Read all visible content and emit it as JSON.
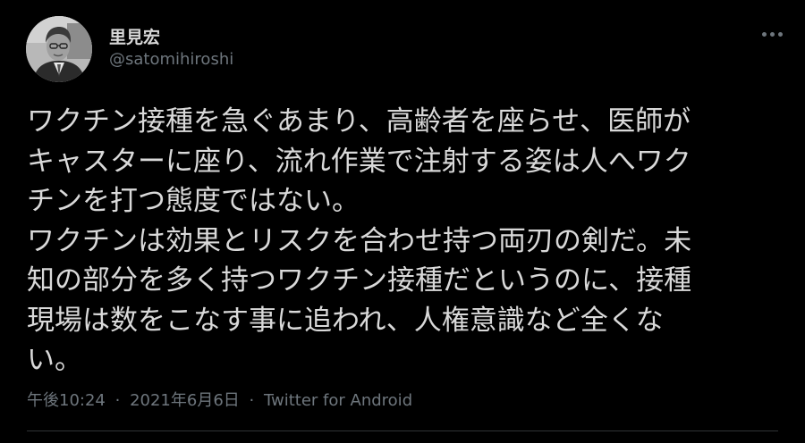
{
  "user": {
    "display_name": "里見宏",
    "handle": "@satomihiroshi",
    "avatar_icon": "profile-photo"
  },
  "tweet": {
    "lines": [
      "ワクチン接種を急ぐあまり、高齢者を座らせ、医師が",
      "キャスターに座り、流れ作業で注射する姿は人へワク",
      "チンを打つ態度ではない。",
      "ワクチンは効果とリスクを合わせ持つ両刃の剣だ。未",
      "知の部分を多く持つワクチン接種だというのに、接種",
      "現場は数をこなす事に追われ、人権意識など全くな",
      "い。"
    ]
  },
  "meta": {
    "time": "午後10:24",
    "separator": "·",
    "date": "2021年6月6日",
    "source": "Twitter for Android"
  },
  "actions": {
    "more_icon": "more-horizontal-icon"
  },
  "colors": {
    "background": "#000000",
    "text": "#d9d9d9",
    "secondary": "#6e767d",
    "divider": "#2f3336"
  }
}
